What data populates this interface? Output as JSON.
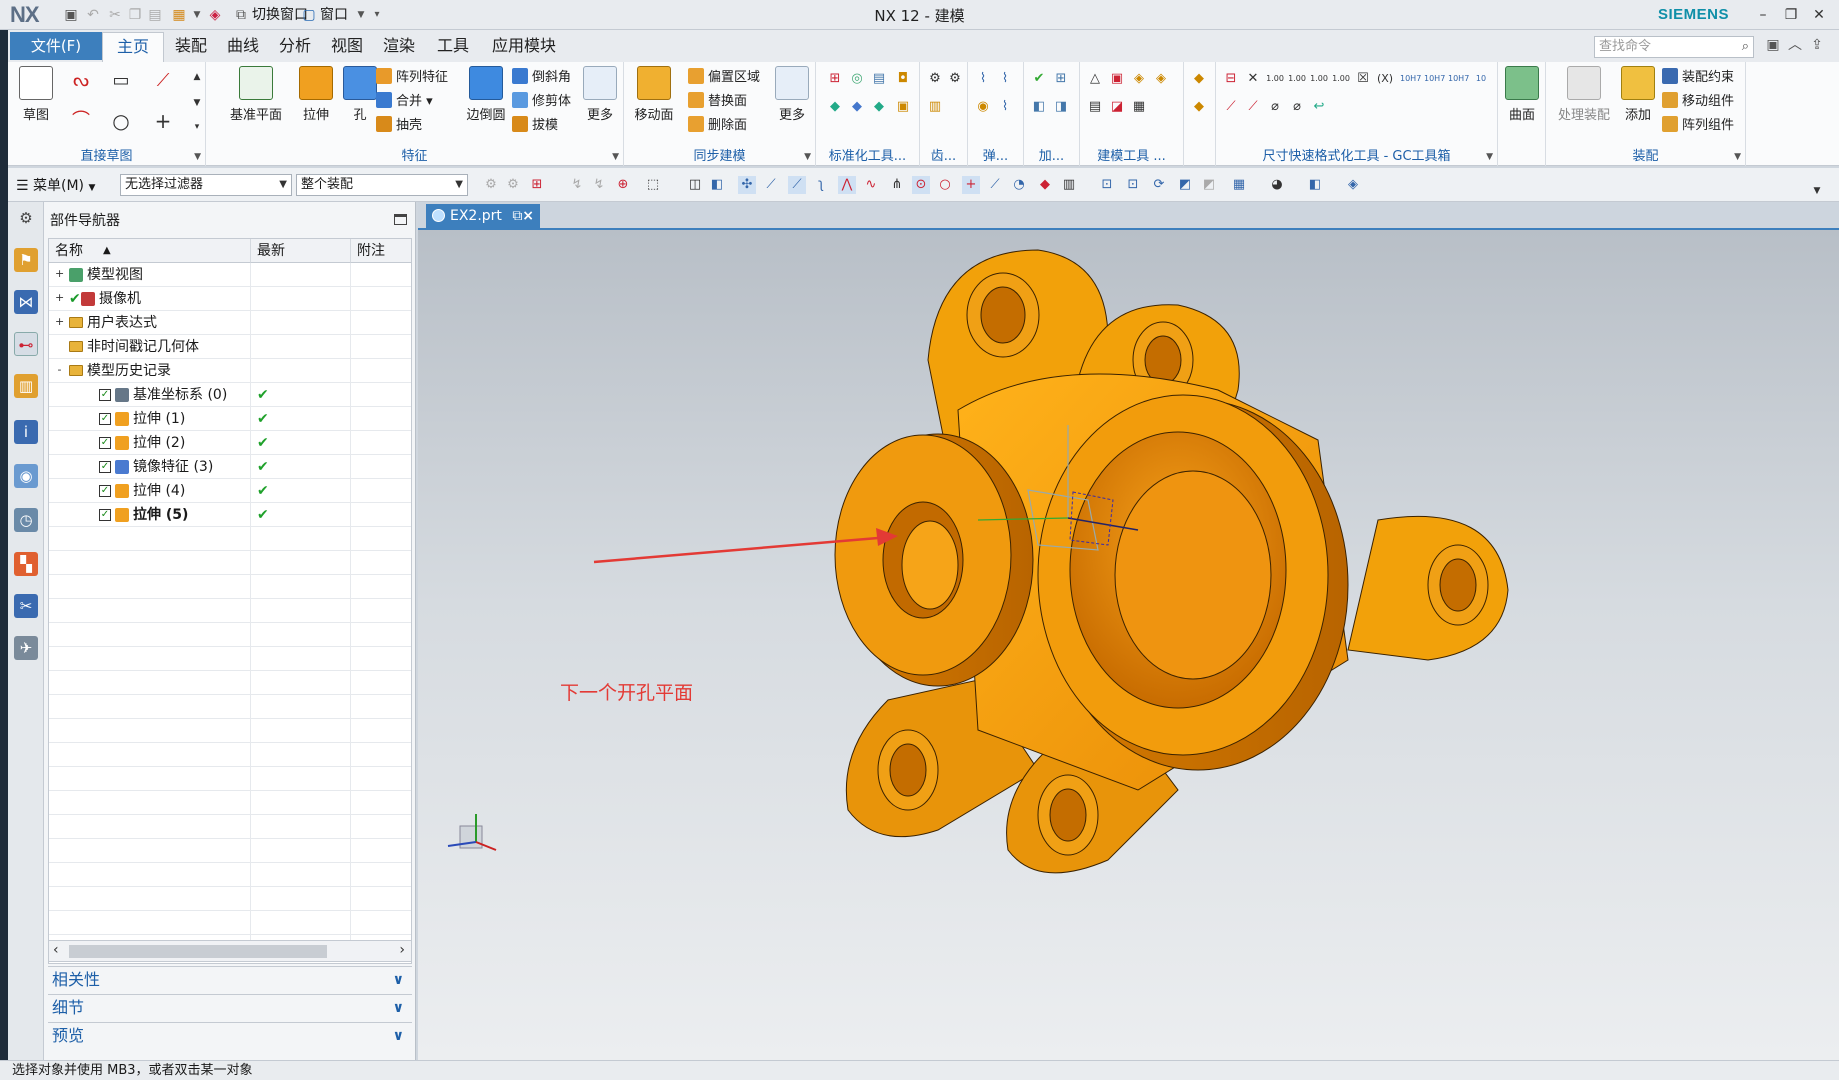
{
  "window": {
    "logo": "NX",
    "title": "NX 12 - 建模",
    "brand": "SIEMENS",
    "switch_window": "切换窗口",
    "window_menu": "窗口"
  },
  "tabs": {
    "file": "文件(F)",
    "items": [
      "主页",
      "装配",
      "曲线",
      "分析",
      "视图",
      "渲染",
      "工具",
      "应用模块"
    ],
    "active": "主页",
    "search_placeholder": "查找命令"
  },
  "ribbon": {
    "direct_sketch": {
      "label": "直接草图",
      "sketch_btn": "草图"
    },
    "feature": {
      "label": "特征",
      "datum_plane": "基准平面",
      "extrude": "拉伸",
      "hole": "孔",
      "pattern_feature": "阵列特征",
      "combine": "合并",
      "shell": "抽壳",
      "edge_blend": "边倒圆",
      "chamfer": "倒斜角",
      "trim_body": "修剪体",
      "draft": "拔模",
      "more": "更多"
    },
    "sync_modeling": {
      "label": "同步建模",
      "move_face": "移动面",
      "offset_region": "偏置区域",
      "replace_face": "替换面",
      "delete_face": "删除面",
      "more": "更多"
    },
    "other_groups": [
      "标准化工具...",
      "齿...",
      "弹...",
      "加...",
      "建模工具 ...",
      "尺寸快速格式化工具 - GC工具箱"
    ],
    "surface": {
      "label": "曲面"
    },
    "assembly": {
      "label": "装配",
      "process_assembly": "处理装配",
      "add": "添加",
      "assembly_constraint": "装配约束",
      "move_component": "移动组件",
      "pattern_component": "阵列组件"
    }
  },
  "selection_bar": {
    "menu": "菜单(M)",
    "filter": "无选择过滤器",
    "scope": "整个装配"
  },
  "navigator": {
    "title": "部件导航器",
    "columns": [
      "名称",
      "最新",
      "附注"
    ],
    "rows": [
      {
        "label": "模型视图",
        "level": 0,
        "expander": "+",
        "icon": "model-view-icon",
        "check": false,
        "latest": ""
      },
      {
        "label": "摄像机",
        "level": 0,
        "expander": "+",
        "icon": "camera-icon",
        "check": false,
        "latest": ""
      },
      {
        "label": "用户表达式",
        "level": 0,
        "expander": "+",
        "icon": "folder-icon",
        "check": false,
        "latest": ""
      },
      {
        "label": "非时间戳记几何体",
        "level": 0,
        "expander": "",
        "icon": "folder-icon",
        "check": false,
        "latest": ""
      },
      {
        "label": "模型历史记录",
        "level": 0,
        "expander": "-",
        "icon": "folder-icon",
        "check": false,
        "latest": ""
      },
      {
        "label": "基准坐标系 (0)",
        "level": 1,
        "expander": "",
        "icon": "datum-csys-icon",
        "check": true,
        "latest": "✔"
      },
      {
        "label": "拉伸 (1)",
        "level": 1,
        "expander": "",
        "icon": "extrude-icon",
        "check": true,
        "latest": "✔"
      },
      {
        "label": "拉伸 (2)",
        "level": 1,
        "expander": "",
        "icon": "extrude-icon",
        "check": true,
        "latest": "✔"
      },
      {
        "label": "镜像特征 (3)",
        "level": 1,
        "expander": "",
        "icon": "mirror-feature-icon",
        "check": true,
        "latest": "✔"
      },
      {
        "label": "拉伸 (4)",
        "level": 1,
        "expander": "",
        "icon": "extrude-icon",
        "check": true,
        "latest": "✔"
      },
      {
        "label": "拉伸 (5)",
        "level": 1,
        "expander": "",
        "icon": "extrude-icon",
        "check": true,
        "latest": "✔",
        "bold": true
      }
    ],
    "panels": [
      "相关性",
      "细节",
      "预览"
    ]
  },
  "document_tab": "EX2.prt",
  "annotation": "下一个开孔平面",
  "status": "选择对象并使用 MB3，或者双击某一对象",
  "colors": {
    "accent": "#3d7fbd",
    "model": "#f09a0e",
    "annotation": "#e33a35",
    "check": "#1fa12b"
  }
}
